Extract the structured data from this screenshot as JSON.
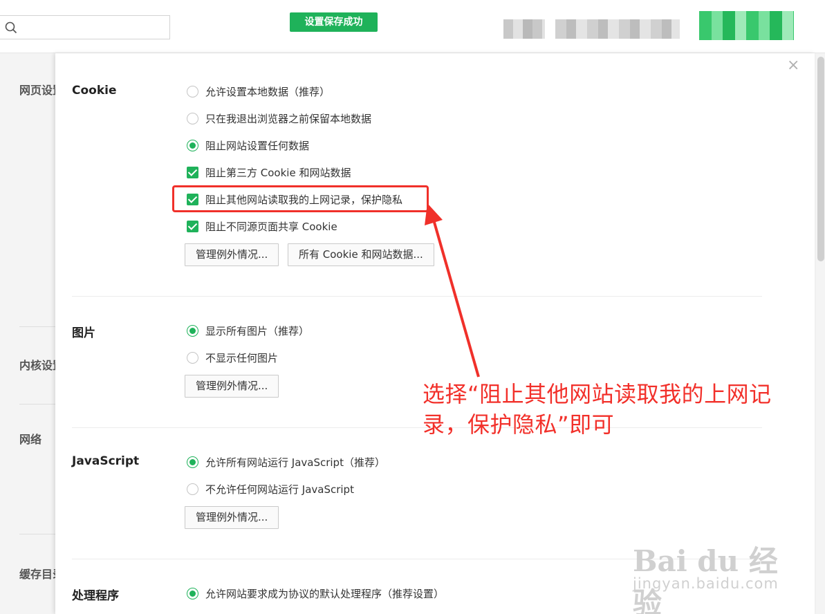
{
  "topbar": {
    "search_placeholder": "",
    "toast": "设置保存成功"
  },
  "nav": {
    "items": [
      "网页设置",
      "内核设置",
      "网络",
      "缓存目录"
    ]
  },
  "sections": {
    "cookie": {
      "title": "Cookie",
      "options": [
        {
          "label": "允许设置本地数据（推荐）",
          "type": "radio",
          "checked": false
        },
        {
          "label": "只在我退出浏览器之前保留本地数据",
          "type": "radio",
          "checked": false
        },
        {
          "label": "阻止网站设置任何数据",
          "type": "radio",
          "checked": true
        },
        {
          "label": "阻止第三方 Cookie 和网站数据",
          "type": "checkbox",
          "checked": true
        },
        {
          "label": "阻止其他网站读取我的上网记录，保护隐私",
          "type": "checkbox",
          "checked": true
        },
        {
          "label": "阻止不同源页面共享 Cookie",
          "type": "checkbox",
          "checked": true
        }
      ],
      "buttons": [
        "管理例外情况...",
        "所有 Cookie 和网站数据..."
      ]
    },
    "images": {
      "title": "图片",
      "options": [
        {
          "label": "显示所有图片（推荐）",
          "type": "radio",
          "checked": true
        },
        {
          "label": "不显示任何图片",
          "type": "radio",
          "checked": false
        }
      ],
      "button": "管理例外情况..."
    },
    "javascript": {
      "title": "JavaScript",
      "options": [
        {
          "label": "允许所有网站运行 JavaScript（推荐）",
          "type": "radio",
          "checked": true
        },
        {
          "label": "不允许任何网站运行 JavaScript",
          "type": "radio",
          "checked": false
        }
      ],
      "button": "管理例外情况..."
    },
    "handlers": {
      "title": "处理程序",
      "options": [
        {
          "label": "允许网站要求成为协议的默认处理程序（推荐设置）",
          "type": "radio",
          "checked": true
        }
      ]
    }
  },
  "annotation": {
    "line1": "选择“阻止其他网站读取我的上网记",
    "line2": "录，保护隐私”即可",
    "color": "#f2302a"
  },
  "watermark": {
    "logo": "Bai du 经验",
    "url": "jingyan.baidu.com"
  },
  "colors": {
    "accent": "#1fb25a",
    "highlight": "#f0302a"
  }
}
